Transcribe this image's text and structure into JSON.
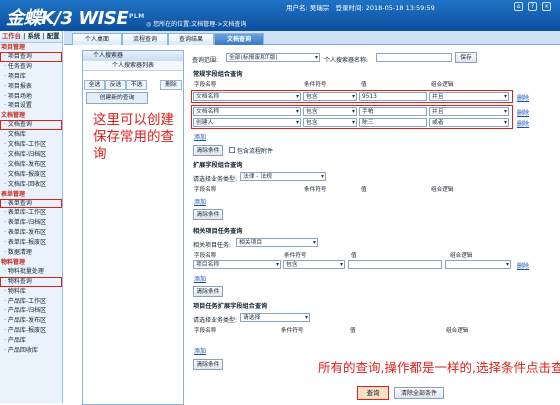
{
  "header": {
    "logo": "金蝶K/3 WISE",
    "logo_sub": "PLM",
    "user_label": "用户名: 吴瑞宗",
    "login_label": "登录时间: 2018-05-18 13:59:59",
    "location": "您所在的位置:文档管理->文档查询",
    "icons": [
      "home-icon",
      "help-icon",
      "logout-icon"
    ]
  },
  "nav": {
    "head_left": "工作台",
    "head_mid": "系统",
    "head_right": "配置",
    "items": [
      {
        "label": "项目管理",
        "group": true
      },
      {
        "label": "项目查询"
      },
      {
        "label": "任务查询"
      },
      {
        "label": "项目库"
      },
      {
        "label": "项目报表"
      },
      {
        "label": "项目场地"
      },
      {
        "label": "项目设置"
      },
      {
        "label": "文档管理",
        "group": true
      },
      {
        "label": "文档查询"
      },
      {
        "label": "文档库"
      },
      {
        "label": "文档库-工作区"
      },
      {
        "label": "文档库-归档区"
      },
      {
        "label": "文档库-发布区"
      },
      {
        "label": "文档库-报废区"
      },
      {
        "label": "文档库-回收区"
      },
      {
        "label": "表单管理",
        "group": true
      },
      {
        "label": "表单查询"
      },
      {
        "label": "表单库-工作区"
      },
      {
        "label": "表单库-归档区"
      },
      {
        "label": "表单库-发布区"
      },
      {
        "label": "表单库-报废区"
      },
      {
        "label": "数据清理"
      },
      {
        "label": "物料管理",
        "group": true
      },
      {
        "label": "物料批量处理"
      },
      {
        "label": "物料查询"
      },
      {
        "label": "物料库"
      },
      {
        "label": "产品库-工作区"
      },
      {
        "label": "产品库-归档区"
      },
      {
        "label": "产品库-发布区"
      },
      {
        "label": "产品库-报废区"
      },
      {
        "label": "产品库"
      },
      {
        "label": "产品回收库"
      }
    ]
  },
  "tabs": [
    {
      "label": "个人桌面"
    },
    {
      "label": "流程查询"
    },
    {
      "label": "查询结果"
    },
    {
      "label": "文档查询",
      "active": true
    }
  ],
  "saved": {
    "title": "个人搜索器",
    "subtitle": "个人搜索器列表",
    "buttons": [
      "全选",
      "反选",
      "不选",
      "删除"
    ],
    "create": "创建新的查询"
  },
  "notes": {
    "mid": "这里可以创建保存常用的查询",
    "bottom": "所有的查询,操作都是一样的,选择条件点击查询"
  },
  "query": {
    "scope_label": "查询范围:",
    "scope_value": "全部(标报废和T版)",
    "searcher_label": "个人搜索器名称:",
    "save": "保存"
  },
  "attr": {
    "title": "常规字段组合查询",
    "col_field": "字段名称",
    "col_cond": "条件符号",
    "col_val": "值",
    "col_logic": "组合逻辑",
    "rows": [
      {
        "field": "文档名称",
        "cond": "包含",
        "val": "9513",
        "logic": "并且",
        "del": "删除"
      },
      {
        "field": "文档名称",
        "cond": "包含",
        "val": "手帕",
        "logic": "并且",
        "del": "删除"
      },
      {
        "field": "创建人",
        "cond": "包含",
        "val": "陈三",
        "logic": "或者",
        "del": "删除"
      }
    ],
    "add": "添加",
    "clear": "清除条件",
    "include": "包含流程附件"
  },
  "ext": {
    "title": "扩展字段组合查询",
    "type_label": "请选择业务类型:",
    "type_value": "法律 - 法规",
    "col_field": "字段名称",
    "col_cond": "条件符号",
    "col_val": "值",
    "col_logic": "组合逻辑",
    "add": "添加",
    "clear": "清除条件"
  },
  "proj": {
    "title": "相关项目任务查询",
    "type_label": "相关项目任务:",
    "type_value": "相关项目",
    "col_field": "字段名称",
    "col_cond": "条件符号",
    "col_val": "值",
    "col_logic": "组合逻辑",
    "row": {
      "field": "项目名称",
      "cond": "包含",
      "del": "删除"
    },
    "add": "添加",
    "clear": "清除条件"
  },
  "task": {
    "title": "项目任务扩展字段组合查询",
    "type_label": "请选择业务类型:",
    "type_value": "请选择",
    "col_field": "字段名称",
    "col_cond": "条件符号",
    "col_val": "值",
    "col_logic": "组合逻辑",
    "add": "添加",
    "clear": "清除条件"
  },
  "actions": {
    "search": "查询",
    "clear_all": "清除全部条件"
  }
}
